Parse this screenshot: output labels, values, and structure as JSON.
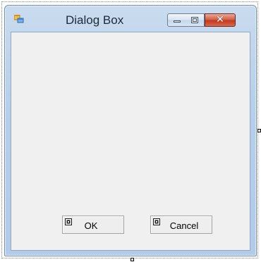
{
  "window": {
    "title": "Dialog Box",
    "icon": "windows-form-icon",
    "caption_buttons": {
      "minimize_icon": "minimize-icon",
      "maximize_icon": "maximize-icon",
      "close_icon": "close-icon",
      "close_glyph": "✕"
    }
  },
  "buttons": {
    "ok": {
      "label": "OK",
      "icon": "component-icon"
    },
    "cancel": {
      "label": "Cancel",
      "icon": "component-icon"
    }
  },
  "colors": {
    "frame": "#b7cfe9",
    "client": "#f0f0f0",
    "close_button": "#c0391e"
  }
}
